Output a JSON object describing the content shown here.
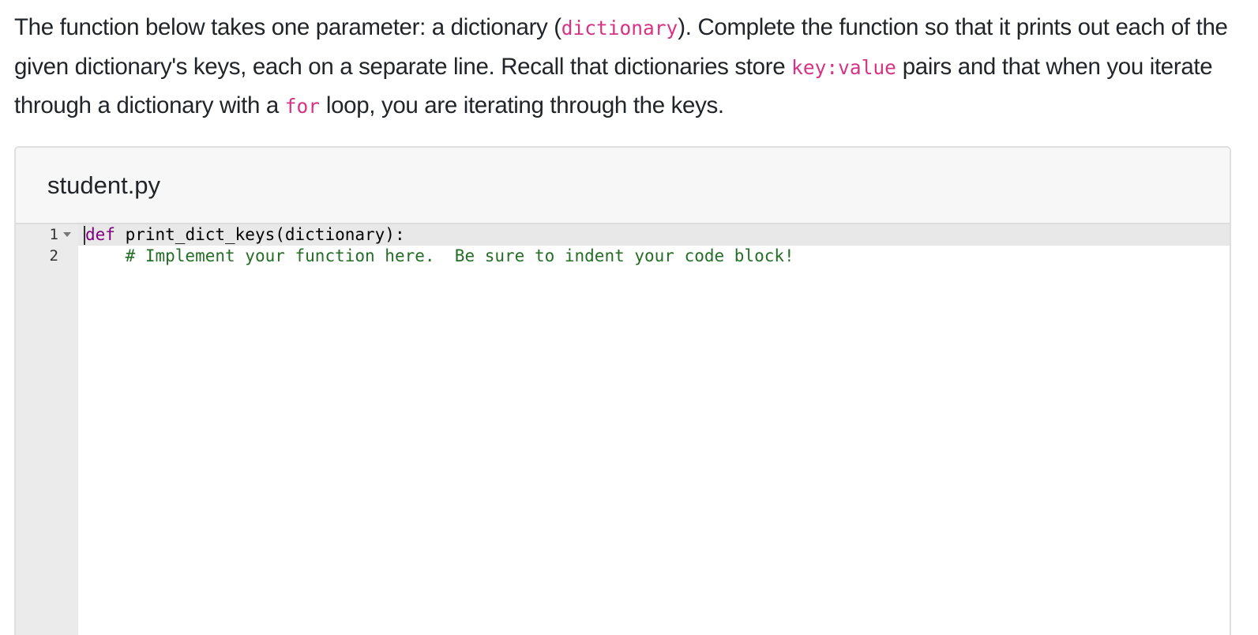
{
  "prompt": {
    "part1": "The function below takes one parameter: a dictionary (",
    "code1": "dictionary",
    "part2": "). Complete the function so that it prints out each of the given dictionary's keys, each on a separate line. Recall that dictionaries store ",
    "code2": "key:value",
    "part3": " pairs and that when you iterate through a dictionary with a ",
    "code3": "for",
    "part4": " loop, you are iterating through the keys."
  },
  "editor": {
    "filename": "student.py",
    "line_numbers": [
      "1",
      "2"
    ],
    "lines": [
      {
        "keyword": "def",
        "rest": " print_dict_keys(dictionary):"
      },
      {
        "indent": "    ",
        "comment": "# Implement your function here.  Be sure to indent your code block!"
      }
    ],
    "fold_icon": "fold-arrow-icon",
    "colors": {
      "keyword": "#800080",
      "comment": "#236e24",
      "inline_code": "#d63384"
    }
  }
}
